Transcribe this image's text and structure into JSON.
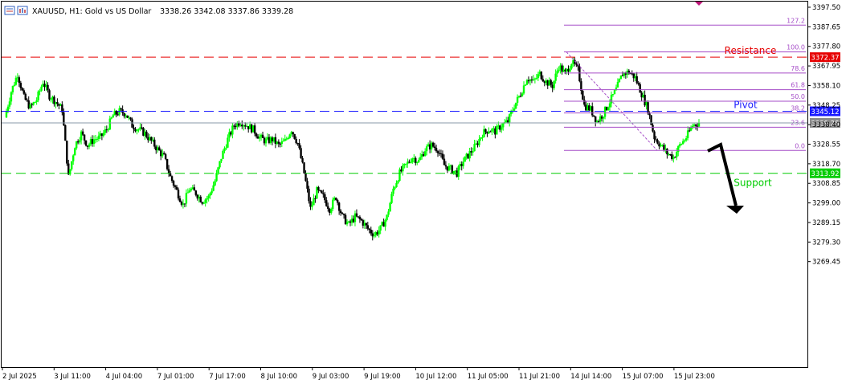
{
  "header": {
    "symbol_line": "XAUUSD, H1:  Gold vs US Dollar",
    "ohlc": "3338.26 3342.08 3337.86 3339.28"
  },
  "colors": {
    "bull": "#00ff00",
    "bear": "#000000",
    "fib": "#a64ec8",
    "resistance": "#e60000",
    "pivot": "#1a1aff",
    "support": "#00cc00",
    "price_line": "#8899aa",
    "arrow": "#000000"
  },
  "chart_data": {
    "type": "candlestick",
    "symbol": "XAUUSD",
    "timeframe": "H1",
    "ylim": [
      3261.9,
      3400.5
    ],
    "y_ticks": [
      "3397.50",
      "3387.65",
      "3377.80",
      "3367.95",
      "3358.10",
      "3348.25",
      "3338.40",
      "3328.55",
      "3318.70",
      "3308.85",
      "3299.00",
      "3289.15",
      "3279.30",
      "3269.45"
    ],
    "x_ticks": [
      "2 Jul 2025",
      "3 Jul 11:00",
      "4 Jul 04:00",
      "7 Jul 01:00",
      "7 Jul 17:00",
      "8 Jul 10:00",
      "9 Jul 03:00",
      "9 Jul 19:00",
      "10 Jul 12:00",
      "11 Jul 05:00",
      "11 Jul 21:00",
      "14 Jul 14:00",
      "15 Jul 07:00",
      "15 Jul 23:00"
    ],
    "close_path": [
      3342,
      3355,
      3364,
      3352,
      3347,
      3351,
      3360,
      3353,
      3350,
      3346,
      3312,
      3328,
      3334,
      3328,
      3331,
      3332,
      3336,
      3343,
      3345,
      3344,
      3338,
      3336,
      3334,
      3330,
      3326,
      3322,
      3312,
      3305,
      3298,
      3306,
      3304,
      3300,
      3302,
      3310,
      3322,
      3331,
      3338,
      3340,
      3338,
      3336,
      3332,
      3330,
      3331,
      3328,
      3330,
      3336,
      3329,
      3314,
      3296,
      3305,
      3302,
      3296,
      3302,
      3292,
      3288,
      3292,
      3290,
      3286,
      3283,
      3286,
      3292,
      3306,
      3314,
      3318,
      3322,
      3320,
      3326,
      3328,
      3326,
      3318,
      3316,
      3314,
      3320,
      3324,
      3328,
      3334,
      3336,
      3335,
      3338,
      3340,
      3348,
      3354,
      3362,
      3360,
      3364,
      3360,
      3358,
      3368,
      3364,
      3370,
      3366,
      3348,
      3346,
      3340,
      3344,
      3350,
      3356,
      3364,
      3365,
      3362,
      3354,
      3346,
      3332,
      3328,
      3324,
      3322,
      3328,
      3332,
      3338,
      3339.28
    ],
    "fibonacci": {
      "levels": [
        {
          "label": "127.2",
          "price": 3388.5
        },
        {
          "label": "100.0",
          "price": 3375.0
        },
        {
          "label": "78.6",
          "price": 3364.4
        },
        {
          "label": "61.8",
          "price": 3356.0
        },
        {
          "label": "50.0",
          "price": 3350.2
        },
        {
          "label": "38.2",
          "price": 3344.3
        },
        {
          "label": "23.6",
          "price": 3337.1
        },
        {
          "label": "0.0",
          "price": 3325.4
        }
      ]
    },
    "horizontal_lines": [
      {
        "name": "Resistance",
        "price": 3372.37,
        "price_label": "3372.37"
      },
      {
        "name": "Pivot",
        "price": 3345.12,
        "price_label": "3345.12"
      },
      {
        "name": "Support",
        "price": 3313.92,
        "price_label": "3313.92"
      }
    ],
    "current_price": 3339.28,
    "current_price_label": "3339.28"
  }
}
